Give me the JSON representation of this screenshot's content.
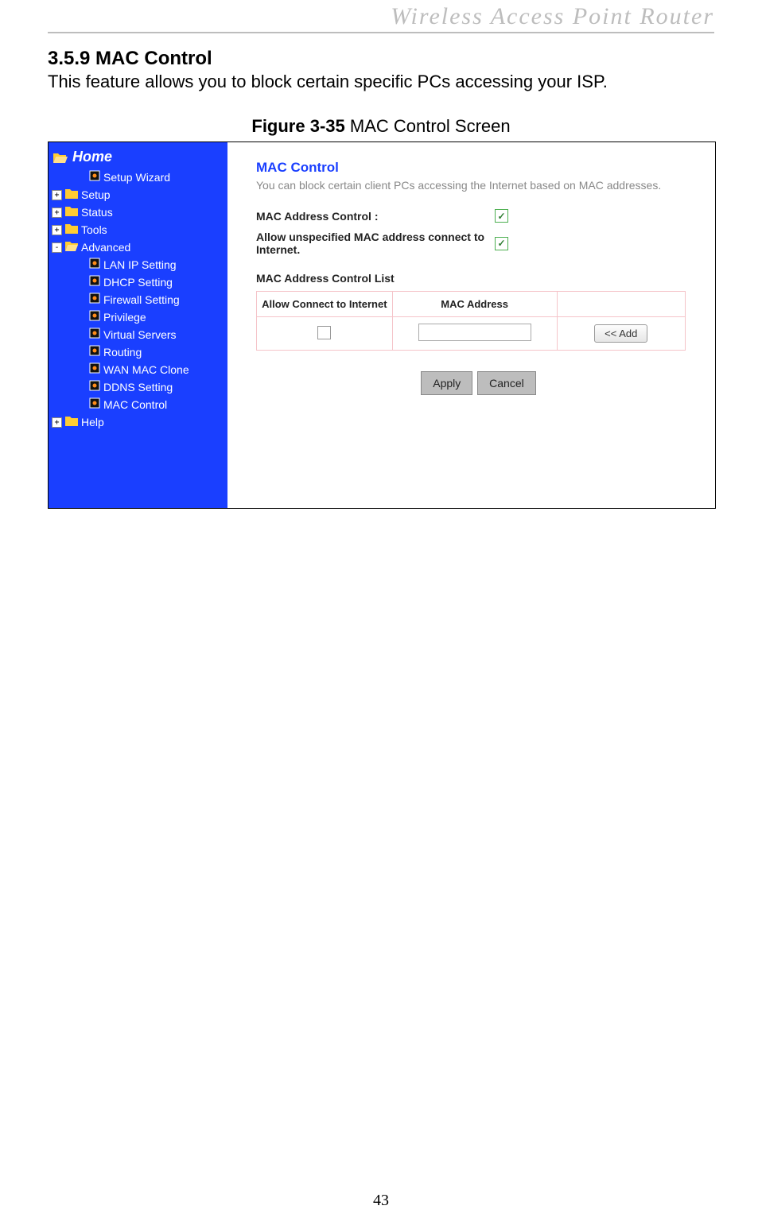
{
  "running_header": "Wireless  Access  Point  Router",
  "section": {
    "number_title": "3.5.9 MAC Control",
    "description": "This feature allows you to block certain specific PCs accessing your ISP."
  },
  "figure": {
    "label": "Figure 3-35",
    "caption": "MAC Control Screen"
  },
  "nav": {
    "home": "Home",
    "items": [
      {
        "toggle": "",
        "icon": "page",
        "label": "Setup Wizard",
        "indent": 1
      },
      {
        "toggle": "+",
        "icon": "folder",
        "label": "Setup",
        "indent": 0
      },
      {
        "toggle": "+",
        "icon": "folder",
        "label": "Status",
        "indent": 0
      },
      {
        "toggle": "+",
        "icon": "folder",
        "label": "Tools",
        "indent": 0
      },
      {
        "toggle": "-",
        "icon": "folder-open",
        "label": "Advanced",
        "indent": 0
      },
      {
        "toggle": "",
        "icon": "page",
        "label": "LAN IP Setting",
        "indent": 1
      },
      {
        "toggle": "",
        "icon": "page",
        "label": "DHCP Setting",
        "indent": 1
      },
      {
        "toggle": "",
        "icon": "page",
        "label": "Firewall Setting",
        "indent": 1
      },
      {
        "toggle": "",
        "icon": "page",
        "label": "Privilege",
        "indent": 1
      },
      {
        "toggle": "",
        "icon": "page",
        "label": "Virtual Servers",
        "indent": 1
      },
      {
        "toggle": "",
        "icon": "page",
        "label": "Routing",
        "indent": 1
      },
      {
        "toggle": "",
        "icon": "page",
        "label": "WAN MAC Clone",
        "indent": 1
      },
      {
        "toggle": "",
        "icon": "page",
        "label": "DDNS Setting",
        "indent": 1
      },
      {
        "toggle": "",
        "icon": "page",
        "label": "MAC Control",
        "indent": 1
      },
      {
        "toggle": "+",
        "icon": "folder",
        "label": "Help",
        "indent": 0
      }
    ]
  },
  "panel": {
    "title": "MAC Control",
    "description": "You can block certain client PCs accessing the Internet based on MAC addresses.",
    "row1_label": "MAC Address Control :",
    "row2_label": "Allow unspecified MAC address connect to Internet.",
    "list_title": "MAC Address Control List",
    "table": {
      "col1": "Allow Connect to Internet",
      "col2": "MAC Address",
      "add_btn": "<< Add"
    },
    "apply_btn": "Apply",
    "cancel_btn": "Cancel"
  },
  "page_number": "43"
}
